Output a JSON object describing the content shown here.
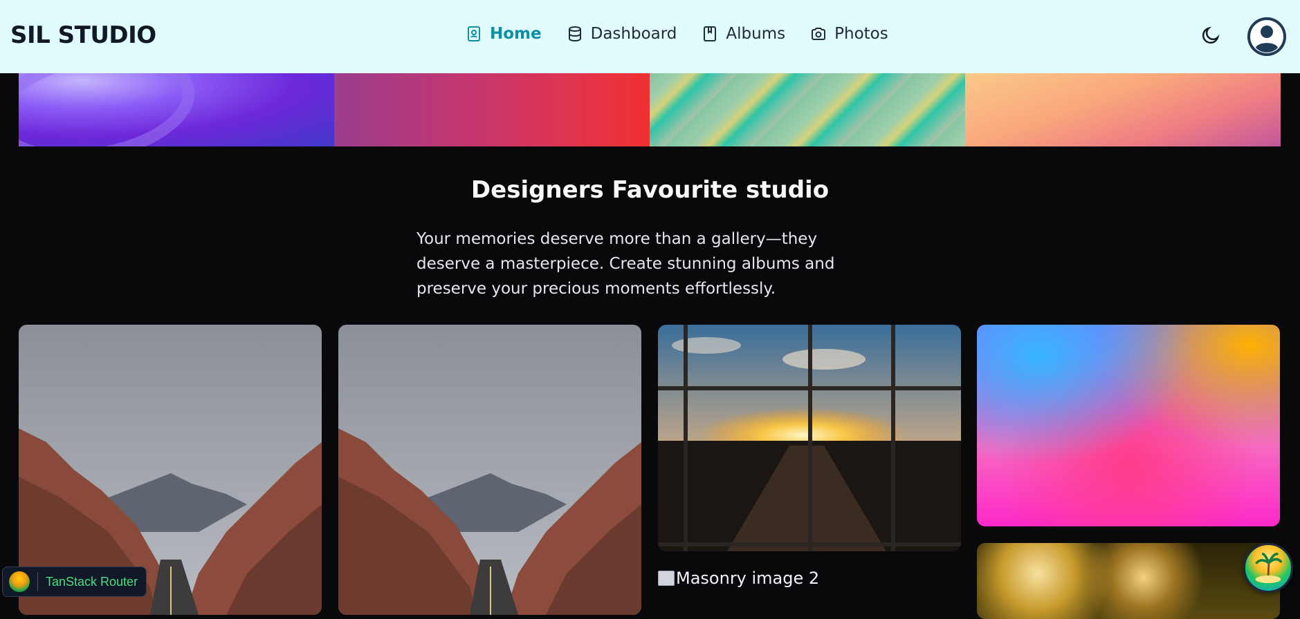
{
  "header": {
    "brand": "SIL STUDIO",
    "nav": [
      {
        "label": "Home",
        "icon": "album-book-icon",
        "active": true
      },
      {
        "label": "Dashboard",
        "icon": "database-icon",
        "active": false
      },
      {
        "label": "Albums",
        "icon": "bookmark-book-icon",
        "active": false
      },
      {
        "label": "Photos",
        "icon": "camera-icon",
        "active": false
      }
    ],
    "theme_toggle_icon": "moon-icon",
    "avatar_icon": "user-circle-icon",
    "active_color": "#0e8fa6"
  },
  "hero": {
    "title": "Designers Favourite studio",
    "description": "Your memories deserve more than a gallery—they deserve a masterpiece. Create stunning albums and preserve your precious moments effortlessly."
  },
  "gallery": {
    "broken_image_alt": "Masonry image 2"
  },
  "devtools": {
    "label": "TanStack Router"
  }
}
